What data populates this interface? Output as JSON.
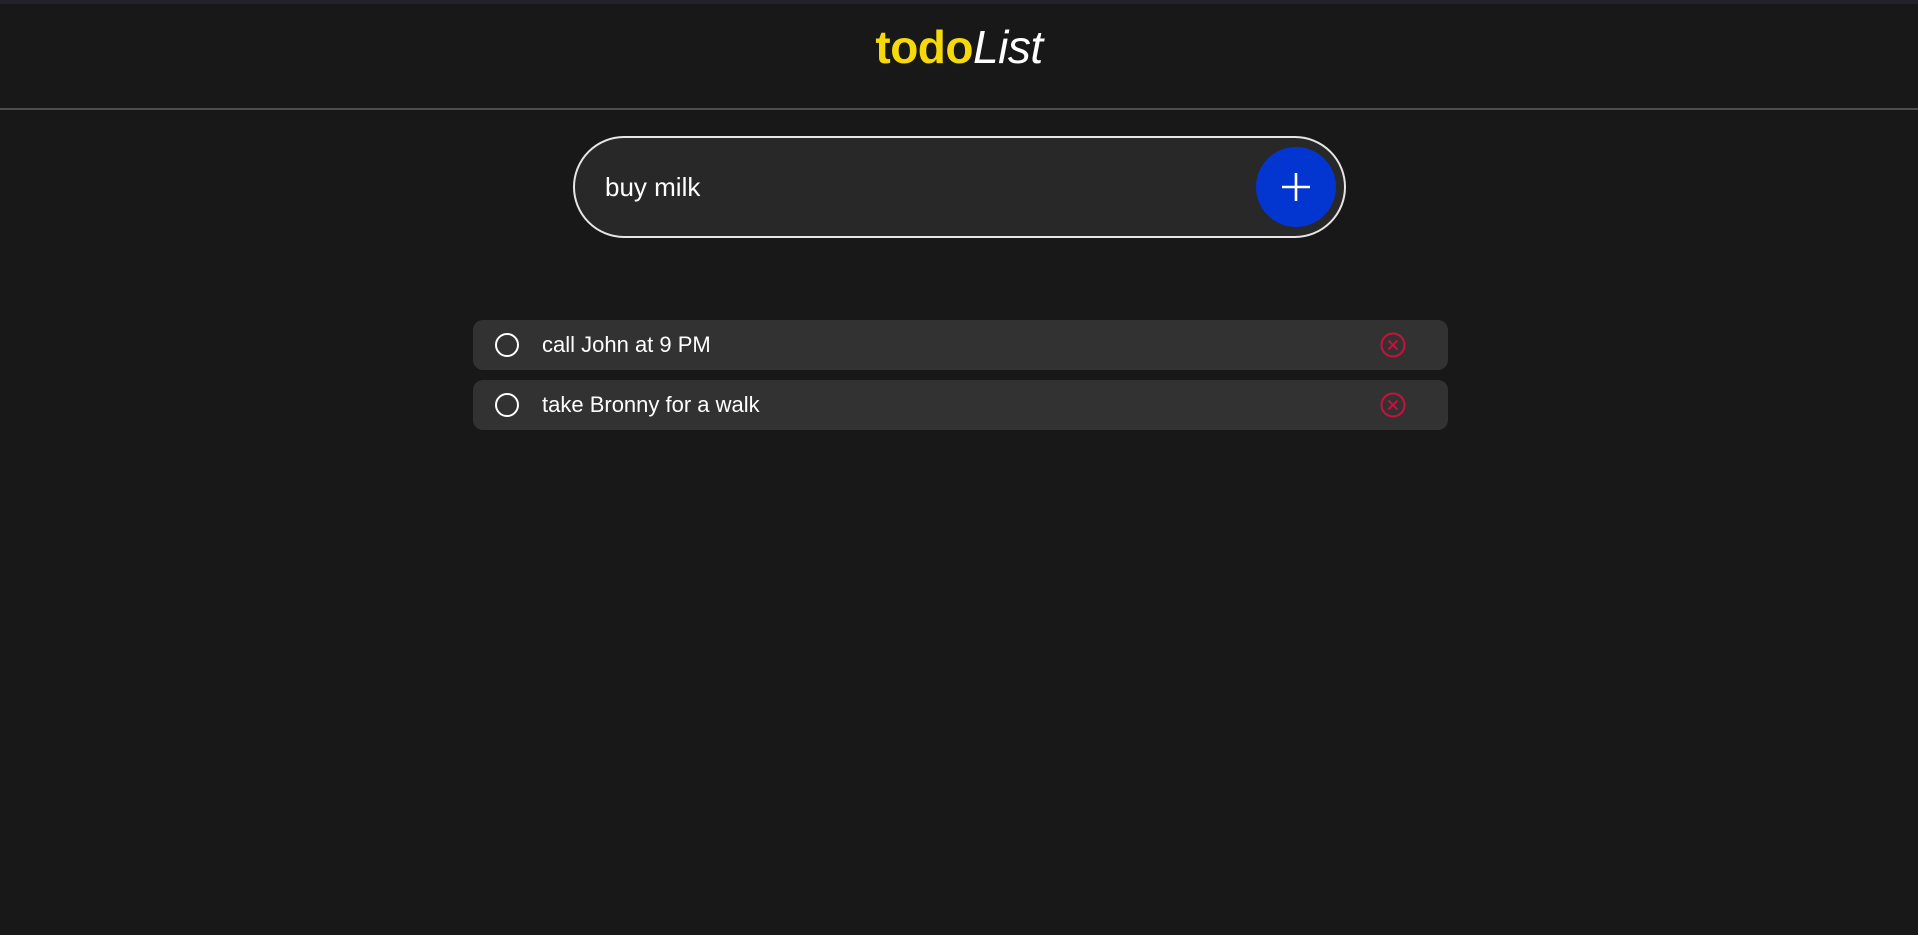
{
  "header": {
    "title_bold": "todo",
    "title_italic": "List"
  },
  "input": {
    "value": "buy milk",
    "placeholder": ""
  },
  "add_button": {
    "icon": "plus-icon"
  },
  "todos": [
    {
      "text": "call John at 9 PM",
      "completed": false
    },
    {
      "text": "take Bronny for a walk",
      "completed": false
    }
  ],
  "colors": {
    "background": "#181818",
    "accent_yellow": "#f5d90a",
    "add_button_blue": "#0336d1",
    "delete_red": "#c8113c",
    "item_bg": "#333233"
  }
}
